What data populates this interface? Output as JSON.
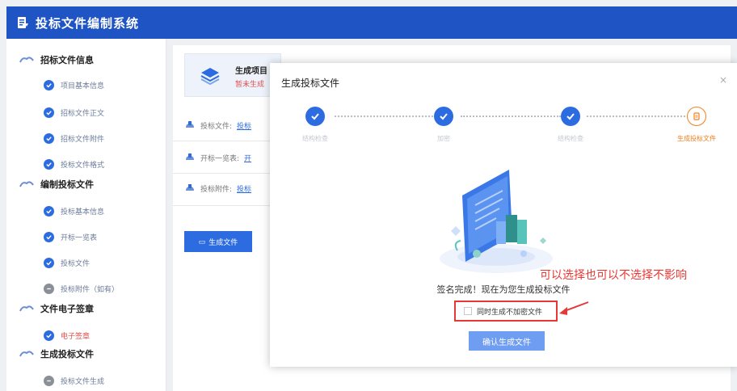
{
  "header": {
    "title": "投标文件编制系统"
  },
  "sidebar": {
    "sections": [
      {
        "label": "招标文件信息",
        "items": [
          {
            "label": "项目基本信息",
            "state": "done"
          },
          {
            "label": "招标文件正文",
            "state": "done"
          },
          {
            "label": "招标文件附件",
            "state": "done"
          },
          {
            "label": "投标文件格式",
            "state": "done"
          }
        ]
      },
      {
        "label": "编制投标文件",
        "items": [
          {
            "label": "投标基本信息",
            "state": "done"
          },
          {
            "label": "开标一览表",
            "state": "done"
          },
          {
            "label": "投标文件",
            "state": "done"
          },
          {
            "label": "投标附件（如有）",
            "state": "pending"
          }
        ]
      },
      {
        "label": "文件电子签章",
        "items": [
          {
            "label": "电子签章",
            "state": "done",
            "color": "red"
          }
        ]
      },
      {
        "label": "生成投标文件",
        "items": [
          {
            "label": "投标文件生成",
            "state": "pending"
          }
        ]
      }
    ]
  },
  "main": {
    "card": {
      "title": "生成项目",
      "status": "暂未生成"
    },
    "rows": [
      {
        "label": "投标文件:",
        "value": "投标"
      },
      {
        "label": "开标一览表:",
        "value": "开"
      },
      {
        "label": "投标附件:",
        "value": "投标"
      }
    ],
    "generate_button": "生成文件"
  },
  "dialog": {
    "title": "生成投标文件",
    "close": "×",
    "steps": [
      {
        "label": "结构检查",
        "state": "done"
      },
      {
        "label": "加密",
        "state": "done"
      },
      {
        "label": "结构检查",
        "state": "done"
      },
      {
        "label": "生成投标文件",
        "state": "current"
      }
    ],
    "done_text": "签名完成！现在为您生成投标文件",
    "checkbox_label": "同时生成不加密文件",
    "checkbox_checked": false,
    "confirm_button": "确认生成文件"
  },
  "annotation": {
    "text": "可以选择也可以不选择不影响"
  },
  "colors": {
    "primary": "#2c6ce0",
    "header": "#1e54c4",
    "accent_orange": "#f08020",
    "annotation_red": "#e53935"
  }
}
